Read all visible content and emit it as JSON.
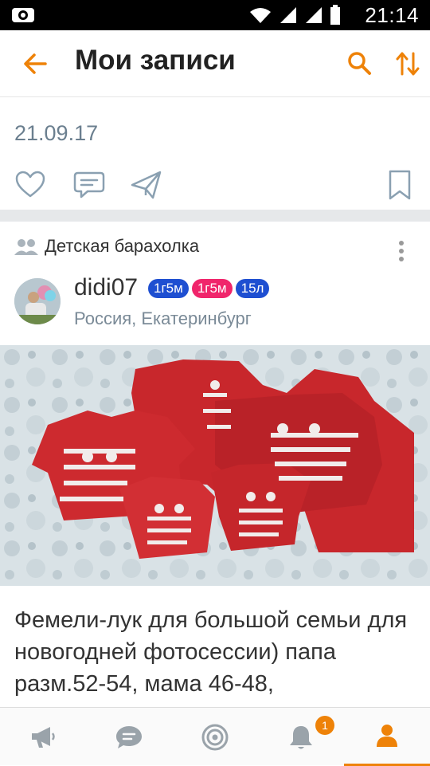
{
  "status_bar": {
    "time": "21:14"
  },
  "app_bar": {
    "title": "Мои записи"
  },
  "post": {
    "date": "21.09.17",
    "group_name": "Детская барахолка",
    "author": {
      "name": "didi07",
      "badges": [
        {
          "text": "1г5м",
          "color": "#1e4fd1"
        },
        {
          "text": "1г5м",
          "color": "#f0256b"
        },
        {
          "text": "15л",
          "color": "#1e4fd1"
        }
      ],
      "location": "Россия, Екатеринбург"
    },
    "text": "Фемели-лук для большой семьи для новогодней фотосессии) папа разм.52-54, мама 46-48,"
  },
  "bottom_nav": {
    "items": [
      "feed",
      "messages",
      "discussions",
      "notifications",
      "profile"
    ],
    "notification_count": "1"
  },
  "colors": {
    "accent": "#ee8208",
    "icon_gray": "#8aa0b1",
    "nav_gray": "#9aa3aa"
  }
}
